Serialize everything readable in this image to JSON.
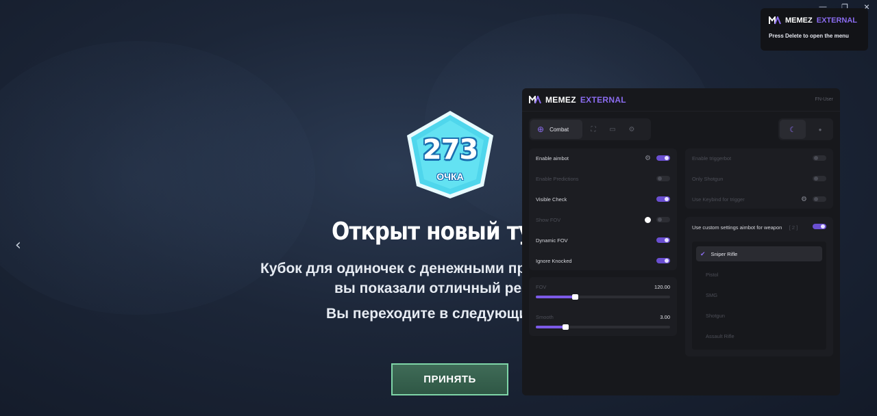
{
  "window": {
    "minimize": "—",
    "restore": "❐",
    "close": "✕"
  },
  "game": {
    "badge_value": "273",
    "badge_label": "ОЧКА",
    "headline": "Открыт новый тур",
    "subtext_line1": "Кубок для одиночек с денежными пр",
    "subtext_line2": "вы показали отличный рез",
    "next_line": "Вы переходите в следующи",
    "accept_label": "ПРИНЯТЬ",
    "prev_arrow": "‹"
  },
  "toast": {
    "brand_first": "MEMEZ",
    "brand_second": "EXTERNAL",
    "hint": "Press Delete to open the menu"
  },
  "menu": {
    "brand_first": "MEMEZ",
    "brand_second": "EXTERNAL",
    "user": "FN-User",
    "tabs": {
      "active_label": "Combat",
      "icons": [
        "crosshair-icon",
        "scan-icon",
        "folder-icon",
        "gear-icon"
      ]
    },
    "theme": {
      "dark_icon": "moon-icon",
      "light_icon": "sun-icon"
    },
    "aimbot": {
      "rows": [
        {
          "label": "Enable aimbot",
          "on": true,
          "enabled": true,
          "gear": true
        },
        {
          "label": "Enable Predictions",
          "on": false,
          "enabled": false,
          "gear": false
        },
        {
          "label": "Visible Check",
          "on": true,
          "enabled": true,
          "gear": false
        },
        {
          "label": "Show FOV",
          "on": false,
          "enabled": false,
          "gear": false,
          "color_swatch": "#ffffff"
        },
        {
          "label": "Dynamic FOV",
          "on": true,
          "enabled": true,
          "gear": false
        },
        {
          "label": "Ignore Knocked",
          "on": true,
          "enabled": true,
          "gear": false
        }
      ]
    },
    "sliders": [
      {
        "label": "FOV",
        "value_text": "120.00",
        "fraction": 0.29
      },
      {
        "label": "Smooth",
        "value_text": "3.00",
        "fraction": 0.22
      }
    ],
    "trigger": {
      "rows": [
        {
          "label": "Enable triggerbot",
          "on": false,
          "gear": false
        },
        {
          "label": "Only Shotgun",
          "on": false,
          "gear": false
        },
        {
          "label": "Use Keybind for trigger",
          "on": false,
          "gear": true
        }
      ]
    },
    "custom": {
      "title": "Use custom settings aimbot for weapon",
      "count": "[ 2 ]",
      "on": true,
      "weapons": [
        {
          "label": "Sniper Rifle",
          "selected": true
        },
        {
          "label": "Pistol",
          "selected": false
        },
        {
          "label": "SMG",
          "selected": false
        },
        {
          "label": "Shotgun",
          "selected": false
        },
        {
          "label": "Assault Rifle",
          "selected": false
        }
      ]
    },
    "accent_color": "#8b6cf0"
  }
}
